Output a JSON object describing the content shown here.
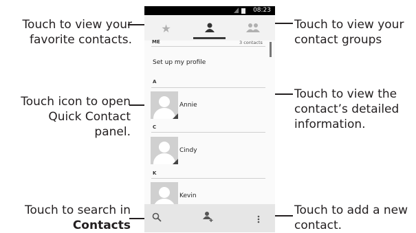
{
  "callouts": {
    "favorites": [
      "Touch to view your",
      "favorite contacts."
    ],
    "quick_contact": [
      "Touch icon to open",
      "Quick Contact",
      "panel."
    ],
    "search_prefix": "Touch to search in",
    "search_bold": "Contacts",
    "groups": [
      "Touch to view your",
      "contact groups"
    ],
    "details": [
      "Touch to view the",
      "contact’s detailed",
      "information."
    ],
    "add": [
      "Touch to add a new",
      "contact."
    ]
  },
  "phone": {
    "status_time": "08:23",
    "tabs": [
      {
        "name": "favorites",
        "icon": "★"
      },
      {
        "name": "contacts",
        "icon": "▲"
      },
      {
        "name": "groups",
        "icon": "☻"
      }
    ],
    "me_header": "ME",
    "contact_count": "3 contacts",
    "setup_profile": "Set up my profile",
    "sections": [
      {
        "letter": "A",
        "name": "Annie"
      },
      {
        "letter": "C",
        "name": "Cindy"
      },
      {
        "letter": "K",
        "name": "Kevin"
      }
    ],
    "bottom_icons": [
      "search-icon",
      "add-contact-icon",
      "overflow-menu-icon"
    ]
  }
}
